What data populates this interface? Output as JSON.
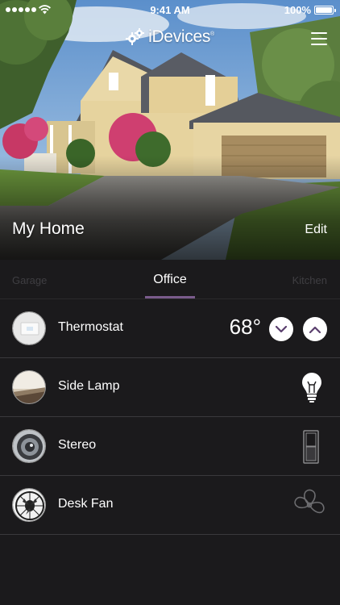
{
  "status_bar": {
    "time": "9:41 AM",
    "battery": "100%"
  },
  "header": {
    "logo_text": "iDevices",
    "logo_mark": "®",
    "menu_icon": "hamburger-menu-icon"
  },
  "home": {
    "title": "My Home",
    "edit_label": "Edit"
  },
  "tabs": [
    {
      "label": "Garage",
      "active": false
    },
    {
      "label": "Office",
      "active": true
    },
    {
      "label": "Kitchen",
      "active": false
    }
  ],
  "devices": [
    {
      "name": "Thermostat",
      "value": "68°",
      "controls": [
        "chevron-down-icon",
        "chevron-up-icon"
      ]
    },
    {
      "name": "Side Lamp",
      "icon": "lightbulb-icon"
    },
    {
      "name": "Stereo",
      "icon": "switch-icon"
    },
    {
      "name": "Desk Fan",
      "icon": "fan-icon"
    }
  ],
  "colors": {
    "background": "#1b1a1c",
    "accent": "#7a5c8c",
    "divider": "#3a393c",
    "inactive_tab": "#3f3e42"
  }
}
